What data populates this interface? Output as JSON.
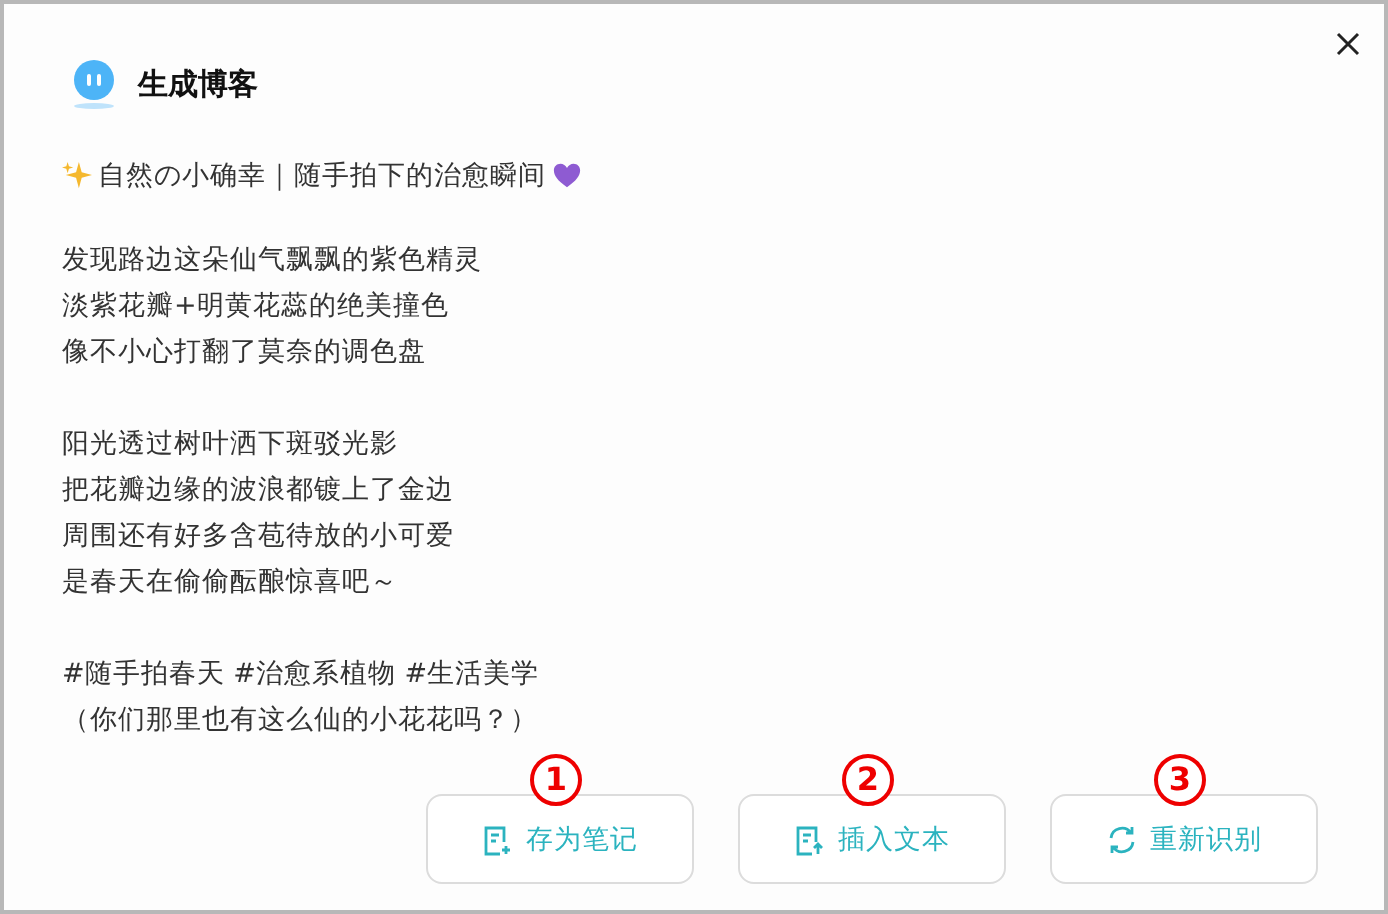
{
  "dialog": {
    "title": "生成博客"
  },
  "headline": "自然の小确幸｜随手拍下的治愈瞬间",
  "paragraphs": [
    {
      "lines": [
        "发现路边这朵仙气飘飘的紫色精灵",
        "淡紫花瓣+明黄花蕊的绝美撞色",
        "像不小心打翻了莫奈的调色盘"
      ]
    },
    {
      "lines": [
        "阳光透过树叶洒下斑驳光影",
        "把花瓣边缘的波浪都镀上了金边",
        "周围还有好多含苞待放的小可爱",
        "是春天在偷偷酝酿惊喜吧～"
      ]
    },
    {
      "lines": [
        "#随手拍春天 #治愈系植物 #生活美学",
        "（你们那里也有这么仙的小花花吗？）"
      ]
    }
  ],
  "buttons": [
    {
      "label": "存为笔记",
      "kind": "note",
      "callout": "1"
    },
    {
      "label": "插入文本",
      "kind": "insert",
      "callout": "2"
    },
    {
      "label": "重新识别",
      "kind": "refresh",
      "callout": "3"
    }
  ]
}
